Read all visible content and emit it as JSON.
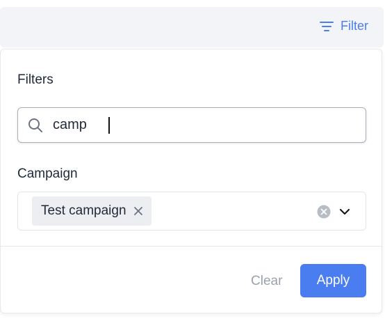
{
  "topbar": {
    "filter_label": "Filter",
    "filter_icon": "filter-icon"
  },
  "panel": {
    "title": "Filters",
    "search": {
      "value": "camp",
      "icon": "search-icon"
    },
    "campaign": {
      "label": "Campaign",
      "selected": [
        "Test campaign"
      ],
      "chip_remove_icon": "close-icon",
      "clear_icon": "clear-circle-icon",
      "dropdown_icon": "chevron-down-icon"
    }
  },
  "footer": {
    "clear_label": "Clear",
    "apply_label": "Apply"
  },
  "colors": {
    "accent": "#4a7df0",
    "muted": "#9aa1ad",
    "chip_bg": "#eceef2"
  }
}
